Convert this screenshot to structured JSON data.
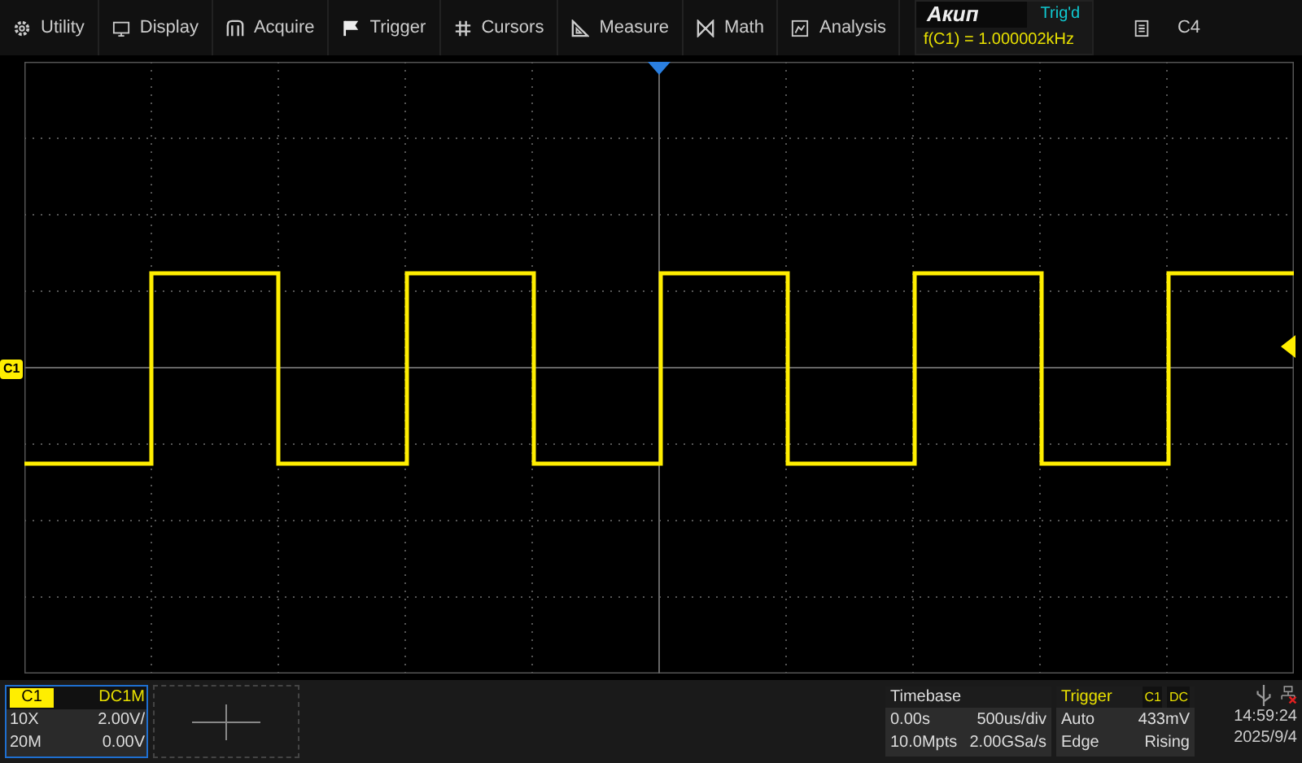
{
  "menu": [
    {
      "kind": "gear",
      "label": "Utility"
    },
    {
      "kind": "monitor",
      "label": "Display"
    },
    {
      "kind": "acquire",
      "label": "Acquire"
    },
    {
      "kind": "flag",
      "label": "Trigger"
    },
    {
      "kind": "hash",
      "label": "Cursors"
    },
    {
      "kind": "ruler",
      "label": "Measure"
    },
    {
      "kind": "math",
      "label": "Math"
    },
    {
      "kind": "analysis",
      "label": "Analysis"
    }
  ],
  "brand": "Акип",
  "trigger_status": "Trig'd",
  "frequency": "f(C1) = 1.000002kHz",
  "notes": {
    "label": "C4"
  },
  "channel_marker": "C1",
  "channel": {
    "name": "C1",
    "coupling": "DC1M",
    "probe": "10X",
    "scale": "2.00V/",
    "bandwidth": "20M",
    "offset": "0.00V"
  },
  "timebase": {
    "title": "Timebase",
    "delay": "0.00s",
    "scale": "500us/div",
    "memory": "10.0Mpts",
    "sample_rate": "2.00GSa/s"
  },
  "trigger": {
    "title": "Trigger",
    "source": "C1",
    "coupling": "DC",
    "mode": "Auto",
    "level": "433mV",
    "type": "Edge",
    "slope": "Rising"
  },
  "clock": {
    "time": "14:59:24",
    "date": "2025/9/4"
  }
}
